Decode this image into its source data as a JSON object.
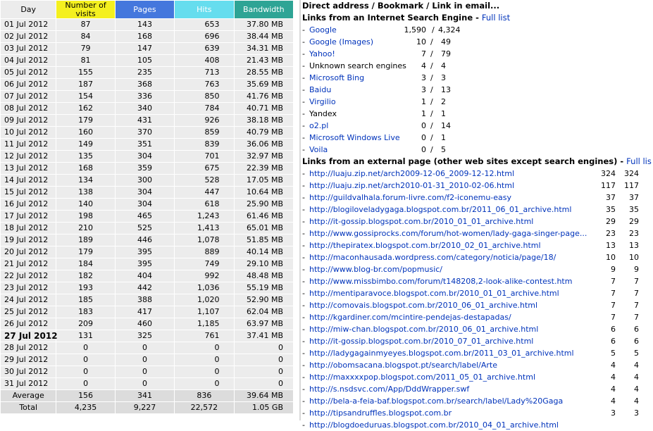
{
  "daily": {
    "headers": {
      "day": "Day",
      "visits": "Number of visits",
      "pages": "Pages",
      "hits": "Hits",
      "bandwidth": "Bandwidth"
    },
    "rows": [
      {
        "day": "01 Jul 2012",
        "visits": "87",
        "pages": "143",
        "hits": "653",
        "bw": "37.80 MB"
      },
      {
        "day": "02 Jul 2012",
        "visits": "84",
        "pages": "168",
        "hits": "696",
        "bw": "38.44 MB"
      },
      {
        "day": "03 Jul 2012",
        "visits": "79",
        "pages": "147",
        "hits": "639",
        "bw": "34.31 MB"
      },
      {
        "day": "04 Jul 2012",
        "visits": "81",
        "pages": "105",
        "hits": "408",
        "bw": "21.43 MB"
      },
      {
        "day": "05 Jul 2012",
        "visits": "155",
        "pages": "235",
        "hits": "713",
        "bw": "28.55 MB"
      },
      {
        "day": "06 Jul 2012",
        "visits": "187",
        "pages": "368",
        "hits": "763",
        "bw": "35.69 MB"
      },
      {
        "day": "07 Jul 2012",
        "visits": "154",
        "pages": "336",
        "hits": "850",
        "bw": "41.76 MB"
      },
      {
        "day": "08 Jul 2012",
        "visits": "162",
        "pages": "340",
        "hits": "784",
        "bw": "40.71 MB"
      },
      {
        "day": "09 Jul 2012",
        "visits": "179",
        "pages": "431",
        "hits": "926",
        "bw": "38.18 MB"
      },
      {
        "day": "10 Jul 2012",
        "visits": "160",
        "pages": "370",
        "hits": "859",
        "bw": "40.79 MB"
      },
      {
        "day": "11 Jul 2012",
        "visits": "149",
        "pages": "351",
        "hits": "839",
        "bw": "36.06 MB"
      },
      {
        "day": "12 Jul 2012",
        "visits": "135",
        "pages": "304",
        "hits": "701",
        "bw": "32.97 MB"
      },
      {
        "day": "13 Jul 2012",
        "visits": "168",
        "pages": "359",
        "hits": "675",
        "bw": "22.39 MB"
      },
      {
        "day": "14 Jul 2012",
        "visits": "134",
        "pages": "300",
        "hits": "528",
        "bw": "17.05 MB"
      },
      {
        "day": "15 Jul 2012",
        "visits": "138",
        "pages": "304",
        "hits": "447",
        "bw": "10.64 MB"
      },
      {
        "day": "16 Jul 2012",
        "visits": "140",
        "pages": "304",
        "hits": "618",
        "bw": "25.90 MB"
      },
      {
        "day": "17 Jul 2012",
        "visits": "198",
        "pages": "465",
        "hits": "1,243",
        "bw": "61.46 MB"
      },
      {
        "day": "18 Jul 2012",
        "visits": "210",
        "pages": "525",
        "hits": "1,413",
        "bw": "65.01 MB"
      },
      {
        "day": "19 Jul 2012",
        "visits": "189",
        "pages": "446",
        "hits": "1,078",
        "bw": "51.85 MB"
      },
      {
        "day": "20 Jul 2012",
        "visits": "179",
        "pages": "395",
        "hits": "889",
        "bw": "40.14 MB"
      },
      {
        "day": "21 Jul 2012",
        "visits": "184",
        "pages": "395",
        "hits": "749",
        "bw": "29.10 MB"
      },
      {
        "day": "22 Jul 2012",
        "visits": "182",
        "pages": "404",
        "hits": "992",
        "bw": "48.48 MB"
      },
      {
        "day": "23 Jul 2012",
        "visits": "193",
        "pages": "442",
        "hits": "1,036",
        "bw": "55.19 MB"
      },
      {
        "day": "24 Jul 2012",
        "visits": "185",
        "pages": "388",
        "hits": "1,020",
        "bw": "52.90 MB"
      },
      {
        "day": "25 Jul 2012",
        "visits": "183",
        "pages": "417",
        "hits": "1,107",
        "bw": "62.04 MB"
      },
      {
        "day": "26 Jul 2012",
        "visits": "209",
        "pages": "460",
        "hits": "1,185",
        "bw": "63.97 MB"
      },
      {
        "day": "27 Jul 2012",
        "visits": "131",
        "pages": "325",
        "hits": "761",
        "bw": "37.41 MB",
        "today": true
      },
      {
        "day": "28 Jul 2012",
        "visits": "0",
        "pages": "0",
        "hits": "0",
        "bw": "0"
      },
      {
        "day": "29 Jul 2012",
        "visits": "0",
        "pages": "0",
        "hits": "0",
        "bw": "0"
      },
      {
        "day": "30 Jul 2012",
        "visits": "0",
        "pages": "0",
        "hits": "0",
        "bw": "0"
      },
      {
        "day": "31 Jul 2012",
        "visits": "0",
        "pages": "0",
        "hits": "0",
        "bw": "0"
      }
    ],
    "average": {
      "day": "Average",
      "visits": "156",
      "pages": "341",
      "hits": "836",
      "bw": "39.64 MB"
    },
    "total": {
      "day": "Total",
      "visits": "4,235",
      "pages": "9,227",
      "hits": "22,572",
      "bw": "1.05 GB"
    }
  },
  "referers": {
    "direct_title": "Direct address / Bookmark / Link in email...",
    "search_title": "Links from an Internet Search Engine",
    "search_full_list": "Full list",
    "search_engines": [
      {
        "name": "Google",
        "pages": "1,590",
        "hits": "4,324",
        "link": true
      },
      {
        "name": "Google (Images)",
        "pages": "10",
        "hits": "49",
        "link": true
      },
      {
        "name": "Yahoo!",
        "pages": "7",
        "hits": "79",
        "link": true
      },
      {
        "name": "Unknown search engines",
        "pages": "4",
        "hits": "4",
        "link": false
      },
      {
        "name": "Microsoft Bing",
        "pages": "3",
        "hits": "3",
        "link": true
      },
      {
        "name": "Baidu",
        "pages": "3",
        "hits": "13",
        "link": true
      },
      {
        "name": "Virgilio",
        "pages": "1",
        "hits": "2",
        "link": true
      },
      {
        "name": "Yandex",
        "pages": "1",
        "hits": "1",
        "link": false
      },
      {
        "name": "o2.pl",
        "pages": "0",
        "hits": "14",
        "link": true
      },
      {
        "name": "Microsoft Windows Live",
        "pages": "0",
        "hits": "1",
        "link": true
      },
      {
        "name": "Voila",
        "pages": "0",
        "hits": "5",
        "link": true
      }
    ],
    "external_title": "Links from an external page (other web sites except search engines)",
    "external_full_list": "Full lis",
    "external_pages": [
      {
        "url": "http://luaju.zip.net/arch2009-12-06_2009-12-12.html",
        "pages": "324",
        "hits": "324"
      },
      {
        "url": "http://luaju.zip.net/arch2010-01-31_2010-02-06.html",
        "pages": "117",
        "hits": "117"
      },
      {
        "url": "http://guildvalhala.forum-livre.com/f2-iconemu-easy",
        "pages": "37",
        "hits": "37"
      },
      {
        "url": "http://blogiloveladygaga.blogspot.com.br/2011_06_01_archive.html",
        "pages": "35",
        "hits": "35"
      },
      {
        "url": "http://it-gossip.blogspot.com.br/2010_01_01_archive.html",
        "pages": "29",
        "hits": "29"
      },
      {
        "url": "http://www.gossiprocks.com/forum/hot-women/lady-gaga-singer-page...",
        "pages": "23",
        "hits": "23"
      },
      {
        "url": "http://thepiratex.blogspot.com.br/2010_02_01_archive.html",
        "pages": "13",
        "hits": "13"
      },
      {
        "url": "http://maconhausada.wordpress.com/category/noticia/page/18/",
        "pages": "10",
        "hits": "10"
      },
      {
        "url": "http://www.blog-br.com/popmusic/",
        "pages": "9",
        "hits": "9"
      },
      {
        "url": "http://www.missbimbo.com/forum/t148208,2-look-alike-contest.htm",
        "pages": "7",
        "hits": "7"
      },
      {
        "url": "http://mentiparavoce.blogspot.com.br/2010_01_01_archive.html",
        "pages": "7",
        "hits": "7"
      },
      {
        "url": "http://comovais.blogspot.com.br/2010_06_01_archive.html",
        "pages": "7",
        "hits": "7"
      },
      {
        "url": "http://kgardiner.com/mcintire-pendejas-destapadas/",
        "pages": "7",
        "hits": "7"
      },
      {
        "url": "http://miw-chan.blogspot.com.br/2010_06_01_archive.html",
        "pages": "6",
        "hits": "6"
      },
      {
        "url": "http://it-gossip.blogspot.com.br/2010_07_01_archive.html",
        "pages": "6",
        "hits": "6"
      },
      {
        "url": "http://ladygagainmyeyes.blogspot.com.br/2011_03_01_archive.html",
        "pages": "5",
        "hits": "5"
      },
      {
        "url": "http://obomsacana.blogspot.pt/search/label/Arte",
        "pages": "4",
        "hits": "4"
      },
      {
        "url": "http://maxxxxpop.blogspot.com/2011_05_01_archive.html",
        "pages": "4",
        "hits": "4"
      },
      {
        "url": "http://s.nsdsvc.com/App/DddWrapper.swf",
        "pages": "4",
        "hits": "4"
      },
      {
        "url": "http://bela-a-feia-baf.blogspot.com.br/search/label/Lady%20Gaga",
        "pages": "4",
        "hits": "4"
      },
      {
        "url": "http://tipsandruffles.blogspot.com.br",
        "pages": "3",
        "hits": "3"
      },
      {
        "url": "http://blogdoeduruas.blogspot.com.br/2010_04_01_archive.html",
        "pages": "",
        "hits": ""
      }
    ]
  }
}
